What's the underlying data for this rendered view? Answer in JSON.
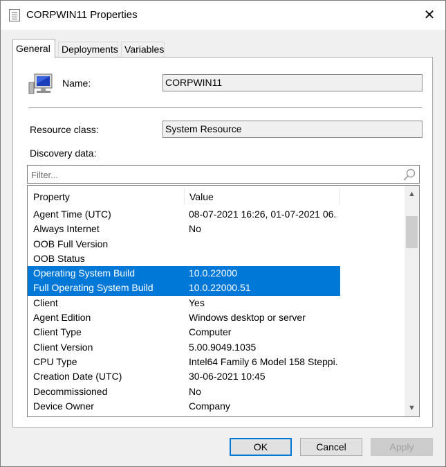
{
  "window": {
    "title": "CORPWIN11 Properties",
    "close_glyph": "✕"
  },
  "tabs": [
    {
      "label": "General",
      "active": true
    },
    {
      "label": "Deployments",
      "active": false
    },
    {
      "label": "Variables",
      "active": false
    }
  ],
  "general": {
    "name_label": "Name:",
    "name_value": "CORPWIN11",
    "resource_class_label": "Resource class:",
    "resource_class_value": "System Resource",
    "discovery_label": "Discovery data:",
    "filter_placeholder": "Filter...",
    "computer_icon": "computer-icon"
  },
  "table": {
    "columns": [
      "Property",
      "Value"
    ],
    "rows": [
      {
        "property": "Agent Time (UTC)",
        "value": "08-07-2021 16:26, 01-07-2021 06...",
        "selected": false
      },
      {
        "property": "Always Internet",
        "value": "No",
        "selected": false
      },
      {
        "property": "OOB Full Version",
        "value": "",
        "selected": false
      },
      {
        "property": "OOB Status",
        "value": "",
        "selected": false
      },
      {
        "property": "Operating System Build",
        "value": "10.0.22000",
        "selected": true
      },
      {
        "property": "Full Operating System Build",
        "value": "10.0.22000.51",
        "selected": true
      },
      {
        "property": "Client",
        "value": "Yes",
        "selected": false
      },
      {
        "property": "Agent Edition",
        "value": "Windows desktop or server",
        "selected": false
      },
      {
        "property": "Client Type",
        "value": "Computer",
        "selected": false
      },
      {
        "property": "Client Version",
        "value": "5.00.9049.1035",
        "selected": false
      },
      {
        "property": "CPU Type",
        "value": "Intel64 Family 6 Model 158 Steppi...",
        "selected": false
      },
      {
        "property": "Creation Date (UTC)",
        "value": "30-06-2021 10:45",
        "selected": false
      },
      {
        "property": "Decommissioned",
        "value": "No",
        "selected": false
      },
      {
        "property": "Device Owner",
        "value": "Company",
        "selected": false
      }
    ]
  },
  "buttons": {
    "ok": "OK",
    "cancel": "Cancel",
    "apply": "Apply"
  },
  "colors": {
    "selection": "#0078d7",
    "default_button_border": "#0078d7"
  }
}
